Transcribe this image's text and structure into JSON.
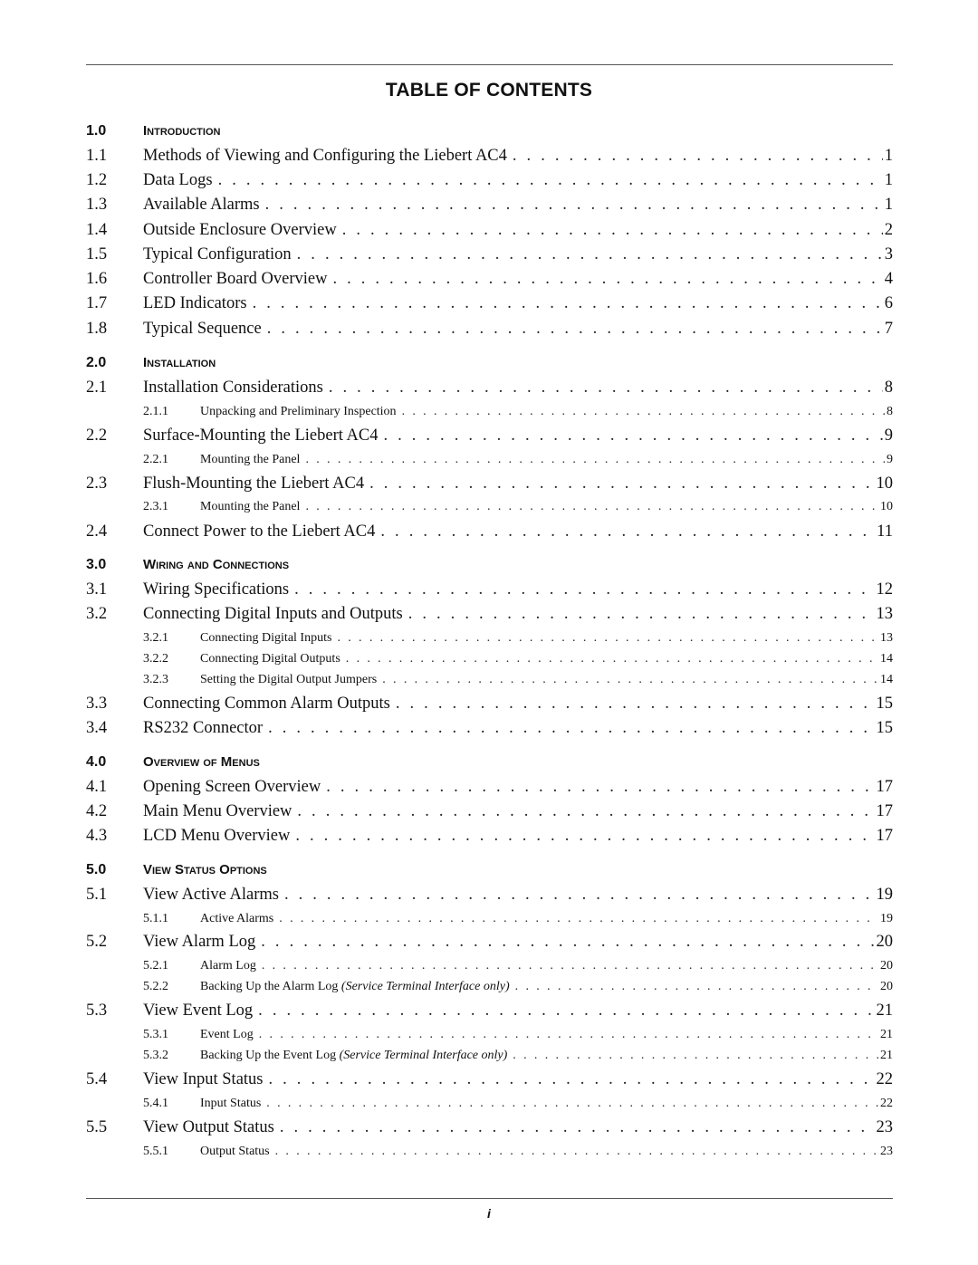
{
  "title": "TABLE OF CONTENTS",
  "footer_page": "i",
  "sections": [
    {
      "num": "1.0",
      "label": "Introduction",
      "entries": [
        {
          "level": 2,
          "num": "1.1",
          "label": "Methods of Viewing and Configuring the Liebert AC4",
          "page": "1"
        },
        {
          "level": 2,
          "num": "1.2",
          "label": "Data Logs",
          "page": "1"
        },
        {
          "level": 2,
          "num": "1.3",
          "label": "Available Alarms",
          "page": "1"
        },
        {
          "level": 2,
          "num": "1.4",
          "label": "Outside Enclosure Overview",
          "page": "2"
        },
        {
          "level": 2,
          "num": "1.5",
          "label": "Typical Configuration",
          "page": "3"
        },
        {
          "level": 2,
          "num": "1.6",
          "label": "Controller Board Overview",
          "page": "4"
        },
        {
          "level": 2,
          "num": "1.7",
          "label": "LED Indicators",
          "page": "6"
        },
        {
          "level": 2,
          "num": "1.8",
          "label": "Typical Sequence",
          "page": "7"
        }
      ]
    },
    {
      "num": "2.0",
      "label": "Installation",
      "entries": [
        {
          "level": 2,
          "num": "2.1",
          "label": "Installation Considerations",
          "page": "8"
        },
        {
          "level": 3,
          "num": "2.1.1",
          "label": "Unpacking and Preliminary Inspection",
          "page": "8"
        },
        {
          "level": 2,
          "num": "2.2",
          "label": "Surface-Mounting the Liebert AC4",
          "page": "9"
        },
        {
          "level": 3,
          "num": "2.2.1",
          "label": "Mounting the Panel",
          "page": "9"
        },
        {
          "level": 2,
          "num": "2.3",
          "label": "Flush-Mounting the Liebert AC4",
          "page": "10"
        },
        {
          "level": 3,
          "num": "2.3.1",
          "label": "Mounting the Panel",
          "page": "10"
        },
        {
          "level": 2,
          "num": "2.4",
          "label": "Connect Power to the Liebert AC4",
          "page": "11"
        }
      ]
    },
    {
      "num": "3.0",
      "label": "Wiring and Connections",
      "entries": [
        {
          "level": 2,
          "num": "3.1",
          "label": "Wiring Specifications",
          "page": "12"
        },
        {
          "level": 2,
          "num": "3.2",
          "label": "Connecting Digital Inputs and Outputs",
          "page": "13"
        },
        {
          "level": 3,
          "num": "3.2.1",
          "label": "Connecting Digital Inputs",
          "page": "13"
        },
        {
          "level": 3,
          "num": "3.2.2",
          "label": "Connecting Digital Outputs",
          "page": "14"
        },
        {
          "level": 3,
          "num": "3.2.3",
          "label": "Setting the Digital Output Jumpers",
          "page": "14"
        },
        {
          "level": 2,
          "num": "3.3",
          "label": "Connecting Common Alarm Outputs",
          "page": "15"
        },
        {
          "level": 2,
          "num": "3.4",
          "label": "RS232 Connector",
          "page": "15"
        }
      ]
    },
    {
      "num": "4.0",
      "label": "Overview of Menus",
      "entries": [
        {
          "level": 2,
          "num": "4.1",
          "label": "Opening Screen Overview",
          "page": "17"
        },
        {
          "level": 2,
          "num": "4.2",
          "label": "Main Menu Overview",
          "page": "17"
        },
        {
          "level": 2,
          "num": "4.3",
          "label": "LCD Menu Overview",
          "page": "17"
        }
      ]
    },
    {
      "num": "5.0",
      "label": "View Status Options",
      "entries": [
        {
          "level": 2,
          "num": "5.1",
          "label": "View Active Alarms",
          "page": "19"
        },
        {
          "level": 3,
          "num": "5.1.1",
          "label": "Active Alarms",
          "page": "19"
        },
        {
          "level": 2,
          "num": "5.2",
          "label": "View Alarm Log",
          "page": "20"
        },
        {
          "level": 3,
          "num": "5.2.1",
          "label": "Alarm Log",
          "page": "20"
        },
        {
          "level": 3,
          "num": "5.2.2",
          "label": "Backing Up the Alarm Log",
          "note": "(Service Terminal Interface only)",
          "page": "20"
        },
        {
          "level": 2,
          "num": "5.3",
          "label": "View Event Log",
          "page": "21"
        },
        {
          "level": 3,
          "num": "5.3.1",
          "label": "Event Log",
          "page": "21"
        },
        {
          "level": 3,
          "num": "5.3.2",
          "label": "Backing Up the Event Log",
          "note": "(Service Terminal Interface only)",
          "page": "21"
        },
        {
          "level": 2,
          "num": "5.4",
          "label": "View Input Status",
          "page": "22"
        },
        {
          "level": 3,
          "num": "5.4.1",
          "label": "Input Status",
          "page": "22"
        },
        {
          "level": 2,
          "num": "5.5",
          "label": "View Output Status",
          "page": "23"
        },
        {
          "level": 3,
          "num": "5.5.1",
          "label": "Output Status",
          "page": "23"
        }
      ]
    }
  ]
}
